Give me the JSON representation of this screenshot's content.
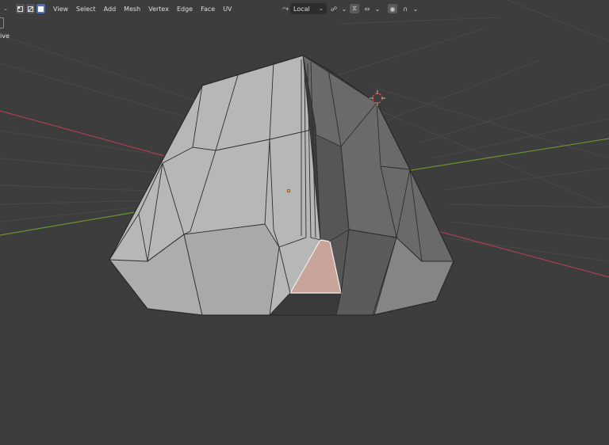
{
  "header": {
    "select_modes": [
      "vertex-select",
      "edge-select",
      "face-select"
    ],
    "active_select_mode": "face-select",
    "menus": [
      "View",
      "Select",
      "Add",
      "Mesh",
      "Vertex",
      "Edge",
      "Face",
      "UV"
    ],
    "transform_orientation": "Local",
    "proportional_edit_icon": "proportional-falloff-icon"
  },
  "viewport": {
    "mode_label": "ive",
    "grid_color": "#494949",
    "x_axis_color": "#a8414e",
    "y_axis_color": "#6c9131",
    "mesh_face_color": "#b7b7b7",
    "mesh_shadow_color": "#5b5b5b",
    "selected_face_color": "#c8a49b",
    "edge_color": "#2e2e2e",
    "origin_color": "#e8a23a",
    "cursor_color": "#d33636"
  }
}
